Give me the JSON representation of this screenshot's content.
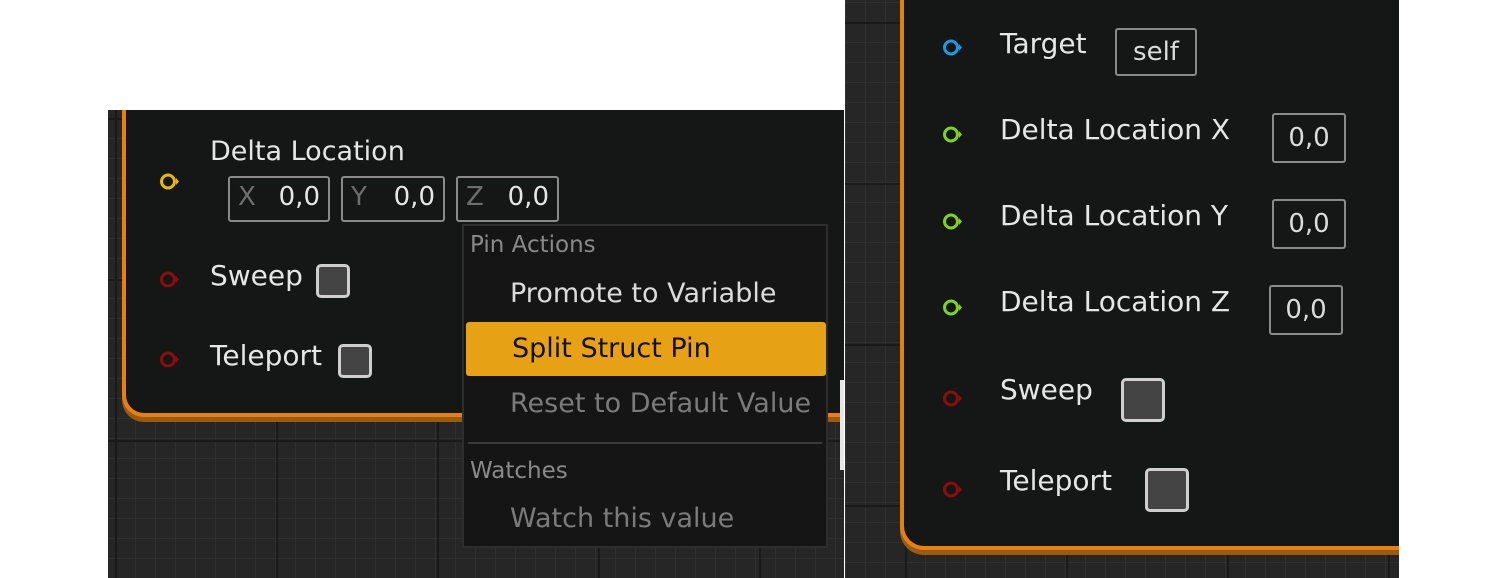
{
  "left_node": {
    "delta_location": {
      "label": "Delta Location",
      "pin_color": "#e6b800",
      "x": {
        "axis": "X",
        "value": "0,0"
      },
      "y": {
        "axis": "Y",
        "value": "0,0"
      },
      "z": {
        "axis": "Z",
        "value": "0,0"
      }
    },
    "sweep": {
      "label": "Sweep",
      "pin_color": "#8b0d0d"
    },
    "teleport": {
      "label": "Teleport",
      "pin_color": "#8b0d0d"
    }
  },
  "context_menu": {
    "pin_actions_header": "Pin Actions",
    "items": [
      {
        "label": "Promote to Variable",
        "state": "normal"
      },
      {
        "label": "Split Struct Pin",
        "state": "highlighted"
      },
      {
        "label": "Reset to Default Value",
        "state": "disabled"
      }
    ],
    "watches_header": "Watches",
    "watch_item": {
      "label": "Watch this value",
      "state": "disabled"
    },
    "highlight_color": "#e6a115"
  },
  "right_node": {
    "target": {
      "label": "Target",
      "value": "self",
      "pin_color": "#1e9ae0"
    },
    "delta_x": {
      "label": "Delta Location X",
      "value": "0,0",
      "pin_color": "#7ed321"
    },
    "delta_y": {
      "label": "Delta Location Y",
      "value": "0,0",
      "pin_color": "#7ed321"
    },
    "delta_z": {
      "label": "Delta Location Z",
      "value": "0,0",
      "pin_color": "#7ed321"
    },
    "sweep": {
      "label": "Sweep",
      "pin_color": "#8b0d0d"
    },
    "teleport": {
      "label": "Teleport",
      "pin_color": "#8b0d0d"
    }
  },
  "colors": {
    "node_border": "#e68010",
    "node_body": "#151616",
    "graph_background": "#262626"
  }
}
